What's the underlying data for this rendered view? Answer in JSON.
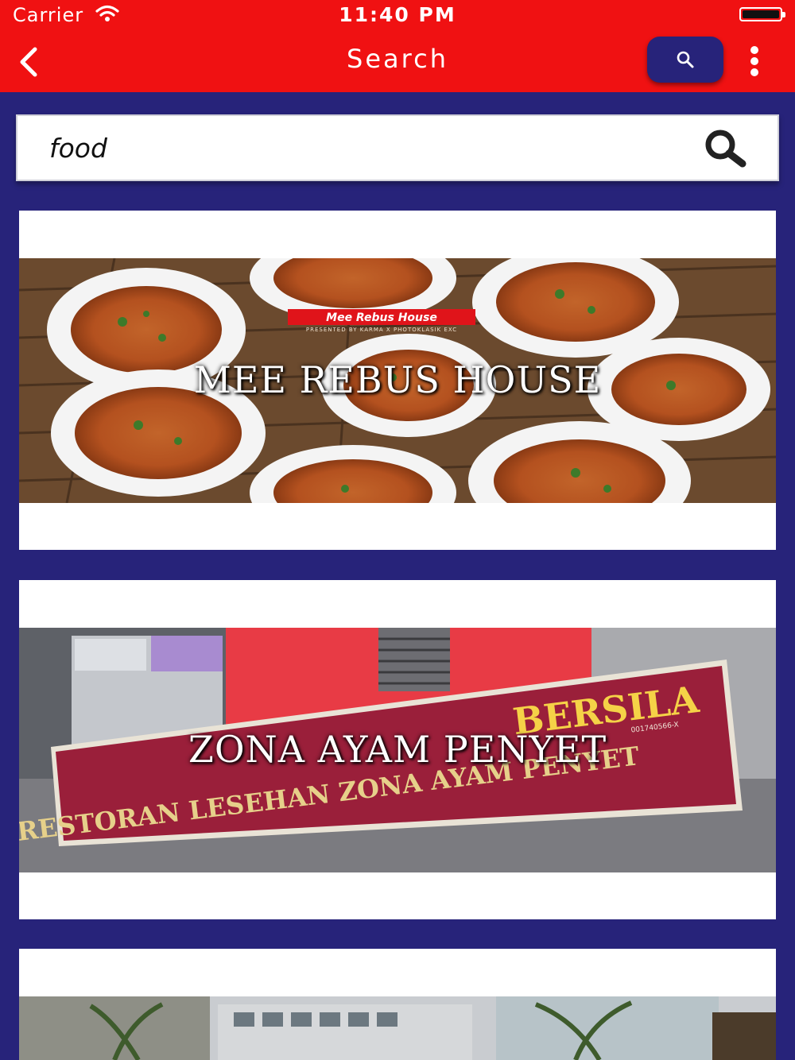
{
  "status_bar": {
    "carrier": "Carrier",
    "time": "11:40 PM"
  },
  "nav": {
    "title": "Search",
    "back_icon": "chevron-left-icon",
    "search_icon": "search-icon",
    "more_icon": "more-vertical-icon"
  },
  "search": {
    "value": "food",
    "icon": "search-icon"
  },
  "results": [
    {
      "title": "MEE REBUS HOUSE",
      "sign_text": "Mee Rebus House",
      "sign_subtext": "PRESENTED BY KARMA X PHOTOKLASIK EXC"
    },
    {
      "title": "ZONA AYAM PENYET",
      "sign_line1": "RESTORAN LESEHAN ZONA AYAM PENYET",
      "sign_top": "BERSILA",
      "sign_reg": "001740566-X"
    },
    {
      "title": ""
    }
  ],
  "colors": {
    "header_red": "#f01112",
    "page_navy": "#27237a",
    "card_white": "#ffffff"
  }
}
